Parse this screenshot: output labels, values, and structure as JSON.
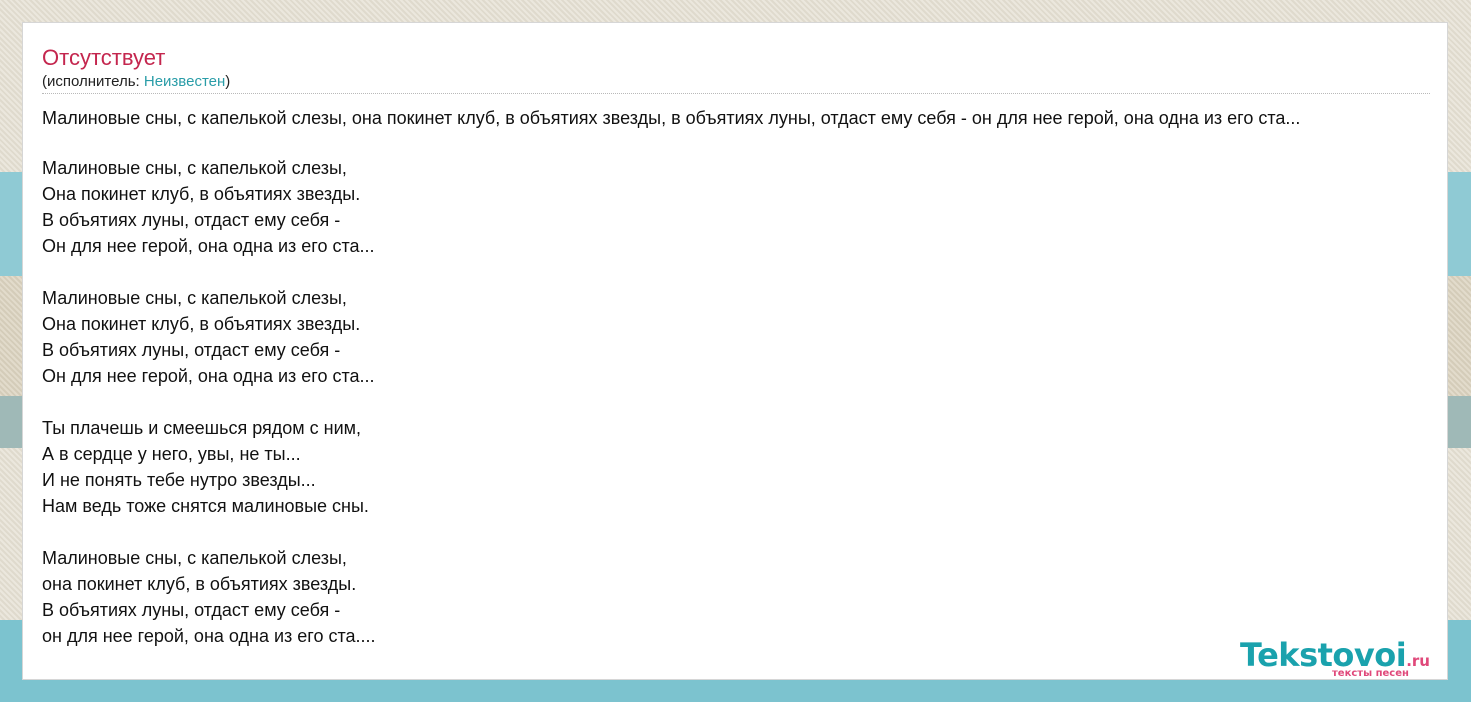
{
  "song": {
    "title": "Отсутствует",
    "artist_prefix": "(исполнитель: ",
    "artist_name": "Неизвестен",
    "artist_suffix": ")"
  },
  "summary": "Малиновые сны, с капелькой слезы, она покинет клуб, в объятиях звезды, в объятиях луны, отдаст ему себя - он для нее герой, она одна из его ста...",
  "lyrics": [
    [
      "Малиновые сны, с капелькой слезы,",
      "Она покинет клуб, в объятиях звезды.",
      "В объятиях луны, отдаст ему себя -",
      "Он для нее герой, она одна из его ста..."
    ],
    [
      "Малиновые сны, с капелькой слезы,",
      "Она покинет клуб, в объятиях звезды.",
      "В объятиях луны, отдаст ему себя -",
      "Он для нее герой, она одна из его ста..."
    ],
    [
      "Ты плачешь и смеешься рядом с ним,",
      "А в сердце у него, увы, не ты...",
      "И не понять тебе нутро звезды...",
      "Нам ведь тоже снятся малиновые сны."
    ],
    [
      "Малиновые сны, с капелькой слезы,",
      "она покинет клуб, в объятиях звезды.",
      "В объятиях луны, отдаст ему себя -",
      "он для нее герой, она одна из его ста...."
    ]
  ],
  "logo": {
    "main": "Tekstovoi",
    "tld": ".ru",
    "tagline": "тексты песен"
  },
  "colors": {
    "title": "#c4264e",
    "link": "#2a9da8",
    "logo_main": "#1aa2ad",
    "logo_accent": "#e0487a"
  }
}
